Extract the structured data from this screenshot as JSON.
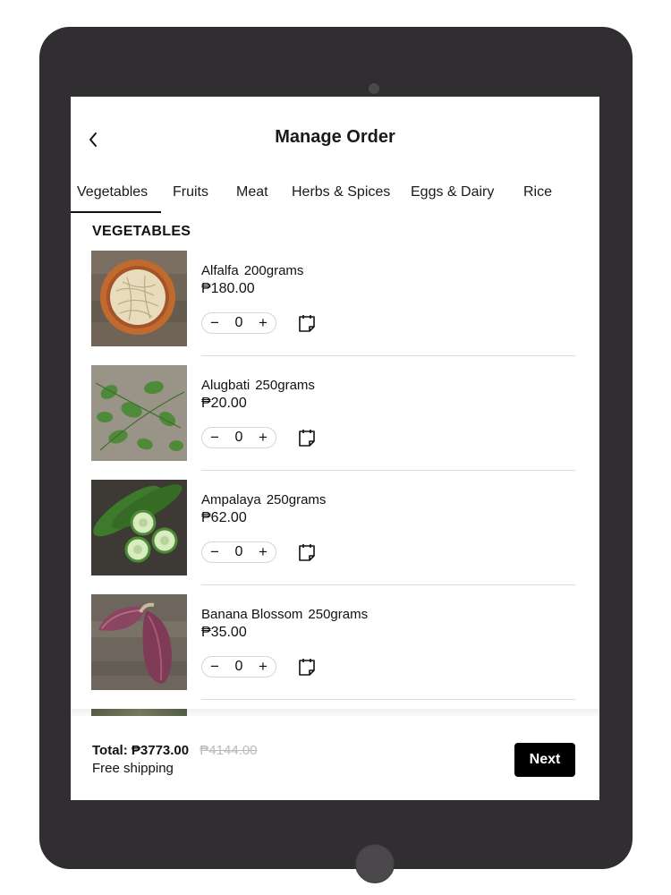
{
  "header": {
    "title": "Manage Order",
    "back_icon": "chevron-left-icon"
  },
  "tabs": [
    {
      "label": "Vegetables",
      "active": true
    },
    {
      "label": "Fruits",
      "active": false
    },
    {
      "label": "Meat",
      "active": false
    },
    {
      "label": "Herbs & Spices",
      "active": false
    },
    {
      "label": "Eggs & Dairy",
      "active": false
    },
    {
      "label": "Rice",
      "active": false
    }
  ],
  "section": {
    "title": "VEGETABLES"
  },
  "items": [
    {
      "name": "Alfalfa",
      "weight": "200grams",
      "price": "₱180.00",
      "quantity": "0",
      "image": "alfalfa-sprouts-photo"
    },
    {
      "name": "Alugbati",
      "weight": "250grams",
      "price": "₱20.00",
      "quantity": "0",
      "image": "alugbati-leaves-photo"
    },
    {
      "name": "Ampalaya",
      "weight": "250grams",
      "price": "₱62.00",
      "quantity": "0",
      "image": "ampalaya-bitter-gourd-photo"
    },
    {
      "name": "Banana Blossom",
      "weight": "250grams",
      "price": "₱35.00",
      "quantity": "0",
      "image": "banana-blossom-photo"
    }
  ],
  "stepper": {
    "minus": "−",
    "plus": "+",
    "note_icon": "note-icon"
  },
  "footer": {
    "total_label": "Total:",
    "total_value": "₱3773.00",
    "original_total": "₱4144.00",
    "shipping": "Free shipping",
    "next_label": "Next"
  }
}
